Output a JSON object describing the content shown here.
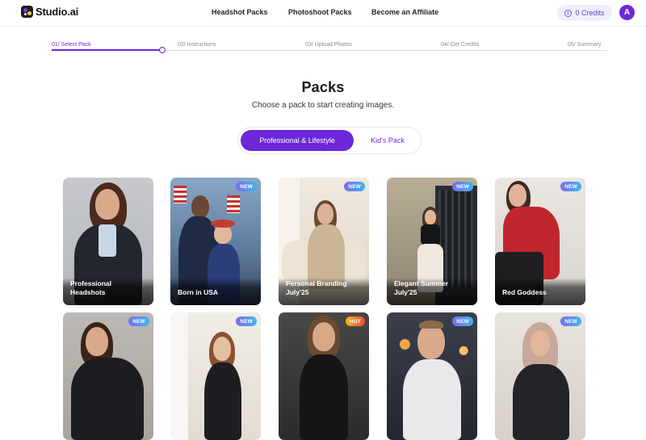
{
  "brand": {
    "name": "Studio.ai"
  },
  "nav": {
    "links": [
      "Headshot Packs",
      "Photoshoot Packs",
      "Become an Affiliate"
    ],
    "credits_label": "0 Credits",
    "avatar_initial": "A"
  },
  "steps": {
    "items": [
      "01/ Select Pack",
      "02/ Instructions",
      "03/ Upload Photos",
      "04/ Get Credits",
      "05/ Summary"
    ],
    "active_index": 0
  },
  "page": {
    "title": "Packs",
    "subtitle": "Choose a pack to start creating images."
  },
  "tabs": {
    "active": "Professional & Lifestyle",
    "inactive": "Kid's Pack"
  },
  "cards": [
    {
      "label": "Professional Headshots",
      "badge": ""
    },
    {
      "label": "Born in USA",
      "badge": "NEW"
    },
    {
      "label": "Personal Branding July'25",
      "badge": "NEW"
    },
    {
      "label": "Elegant Summer July'25",
      "badge": "NEW"
    },
    {
      "label": "Red Goddess",
      "badge": "NEW"
    },
    {
      "label": "",
      "badge": "NEW"
    },
    {
      "label": "",
      "badge": "NEW"
    },
    {
      "label": "",
      "badge": "HOT"
    },
    {
      "label": "",
      "badge": "NEW"
    },
    {
      "label": "",
      "badge": "NEW"
    }
  ],
  "colors": {
    "accent": "#6d28d9",
    "badge_new": "#5a8ef0",
    "badge_hot": "#f07a2f"
  }
}
